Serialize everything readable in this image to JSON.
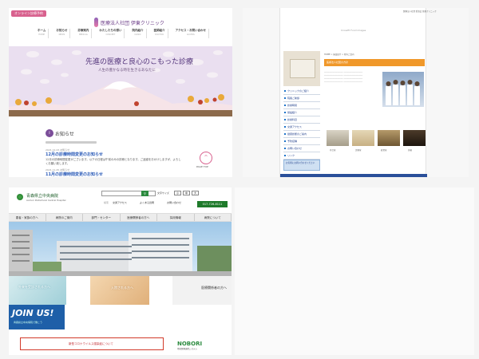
{
  "panel_a": {
    "online_button": "オンライン診療予約",
    "clinic_name": "医療法人社団 伊東クリニック",
    "nav": [
      {
        "label": "ホーム",
        "sub": "HOME"
      },
      {
        "label": "お知らせ",
        "sub": "NEWS"
      },
      {
        "label": "診療案内",
        "sub": "MEDICAL"
      },
      {
        "label": "わたしたちの想い",
        "sub": "CONCEPT"
      },
      {
        "label": "院内紹介",
        "sub": "CLINIC"
      },
      {
        "label": "医師紹介",
        "sub": "DOCTOR"
      },
      {
        "label": "アクセス・お問い合わせ",
        "sub": "ACCESS"
      }
    ],
    "hero_catch": "先進の医療と良心のこもった診療",
    "hero_sub": "人生の豊かなる時を生きるあなたに",
    "news_title": "お知らせ",
    "news_items": [
      {
        "date": "2021.12.23 お知らせ",
        "title": "12月の診療時間変更のお知らせ",
        "text": "12月の診療時間変更がございます。以下の日程は午前のみの診療となります。ご迷惑をおかけしますが、よろしくお願い致します。"
      },
      {
        "date": "2021.11.25 お知らせ",
        "title": "11月の診療時間変更のお知らせ",
        "text": ""
      }
    ],
    "page_top_label": "PAGE TOP"
  },
  "panel_b": {
    "top_text": "医療法人社団 愛清会 佐藤クリニック",
    "alt_text": "Crossfit Fund images",
    "breadcrumb": "HOME > 施設紹介 > 院内ご案内",
    "header": "医療法人社団の方針",
    "sidebar": [
      "クリニックのご紹介",
      "院長ご挨拶",
      "診療時間",
      "施設紹介",
      "診療科目",
      "交通アクセス",
      "健康診断のご案内",
      "予防接種",
      "お問い合わせ",
      "リンク"
    ],
    "banner": "お気軽にお問い合わせください",
    "thumb_captions": [
      "待合室",
      "診察室",
      "処置室",
      "外観"
    ]
  },
  "panel_c": {
    "hospital_name": "青森県立中央病院",
    "hospital_sub": "Aomori Prefectural Central Hospital",
    "search_label": "検索",
    "font_size_label": "文字サイズ",
    "font_sizes": [
      "小",
      "中",
      "大"
    ],
    "quick_links": [
      "交通アクセス",
      "よくある質問",
      "お問い合わせ"
    ],
    "tel": "017-726-8111",
    "nav": [
      "患者・家族の方へ",
      "病院のご案内",
      "部門・センター",
      "医療関係者の方へ",
      "採用情報",
      "病院について"
    ],
    "cards": [
      "外来を受診される方へ",
      "入院される方へ",
      "医療関係者の方へ"
    ],
    "join_title": "JOIN US!",
    "join_sub": "青森県立中央病院で働こう",
    "notice": "新型コロナウイルス感染症について",
    "nobori": "NOBORI",
    "nobori_sub": "地域医療連携システム"
  },
  "colors": {
    "pink": "#d8618e",
    "purple": "#7b4d99",
    "orange": "#f0982a",
    "navy": "#1e3d8a",
    "green": "#2b8a3e",
    "red": "#c1272d"
  }
}
